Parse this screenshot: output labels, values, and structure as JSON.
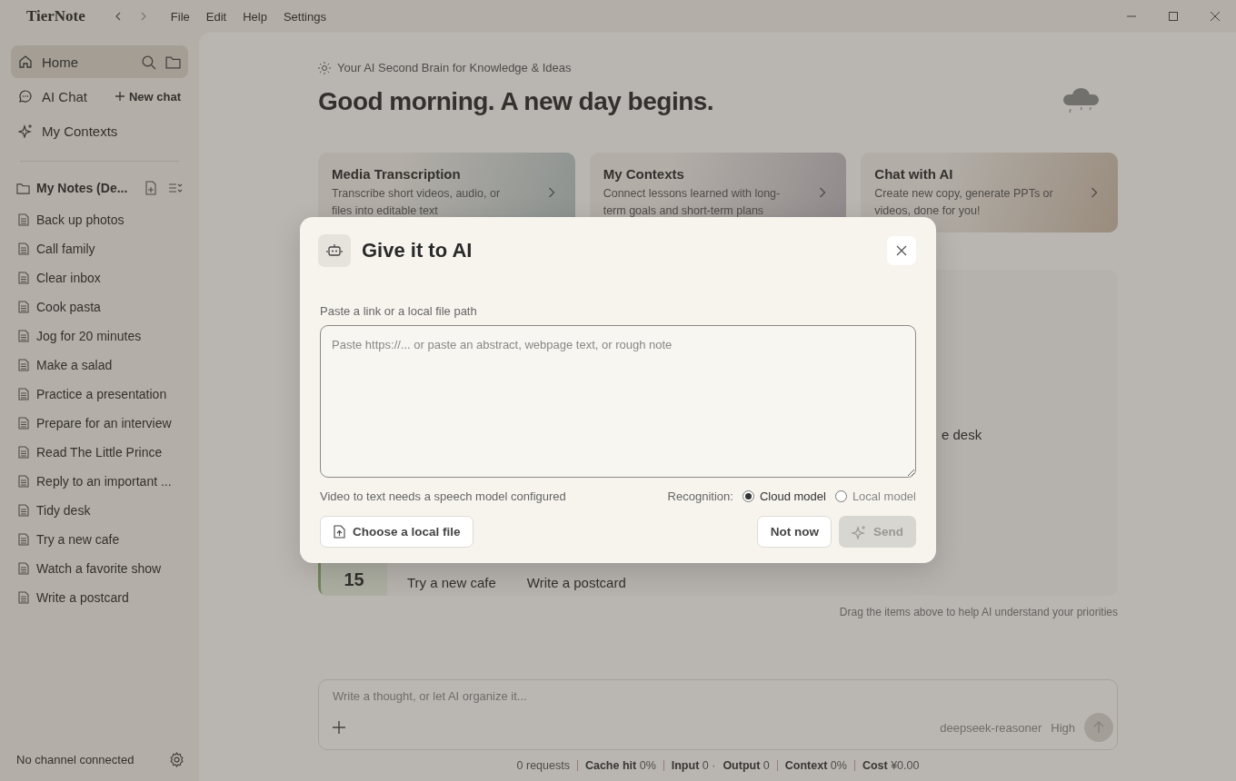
{
  "app": {
    "name": "TierNote"
  },
  "menu": [
    "File",
    "Edit",
    "Help",
    "Settings"
  ],
  "sidebar": {
    "nav": [
      {
        "label": "Home",
        "selected": true,
        "kind": "home"
      },
      {
        "label": "AI Chat",
        "selected": false,
        "kind": "chat",
        "action": "New chat"
      },
      {
        "label": "My Contexts",
        "selected": false,
        "kind": "contexts"
      }
    ],
    "folder": "My Notes (De...",
    "notes": [
      "Back up photos",
      "Call family",
      "Clear inbox",
      "Cook pasta",
      "Jog for 20 minutes",
      "Make a salad",
      "Practice a presentation",
      "Prepare for an interview",
      "Read The Little Prince",
      "Reply to an important ...",
      "Tidy desk",
      "Try a new cafe",
      "Watch a favorite show",
      "Write a postcard"
    ],
    "status": "No channel connected"
  },
  "main": {
    "tagline": "Your AI Second Brain for Knowledge & Ideas",
    "greeting": "Good morning. A new day begins.",
    "cards": [
      {
        "title": "Media Transcription",
        "text": "Transcribe short videos, audio, or files into editable text"
      },
      {
        "title": "My Contexts",
        "text": "Connect lessons learned with long-term goals and short-term plans"
      },
      {
        "title": "Chat with AI",
        "text": "Create new copy, generate PPTs or videos, done for you!"
      }
    ],
    "priorities": {
      "visible_item": "e desk",
      "date": "15",
      "items": [
        "Try a new cafe",
        "Write a postcard"
      ],
      "hint": "Drag the items above to help AI understand your priorities"
    },
    "composer": {
      "placeholder": "Write a thought, or let AI organize it...",
      "model": "deepseek-reasoner",
      "effort": "High"
    },
    "stats": [
      [
        {
          "value": "0 requests"
        }
      ],
      [
        {
          "label": "Cache hit",
          "value": "0%"
        }
      ],
      [
        {
          "label": "Input",
          "value": "0 ·"
        },
        {
          "label": "Output",
          "value": "0"
        }
      ],
      [
        {
          "label": "Context",
          "value": "0%"
        }
      ],
      [
        {
          "label": "Cost",
          "value": "¥0.00"
        }
      ]
    ]
  },
  "dialog": {
    "title": "Give it to AI",
    "field_label": "Paste a link or a local file path",
    "placeholder": "Paste https://... or paste an abstract, webpage text, or rough note",
    "note": "Video to text needs a speech model configured",
    "recognition_label": "Recognition:",
    "options": [
      {
        "label": "Cloud model",
        "selected": true
      },
      {
        "label": "Local model",
        "selected": false
      }
    ],
    "file_button": "Choose a local file",
    "cancel": "Not now",
    "send": {
      "label": "Send",
      "disabled": true
    }
  }
}
